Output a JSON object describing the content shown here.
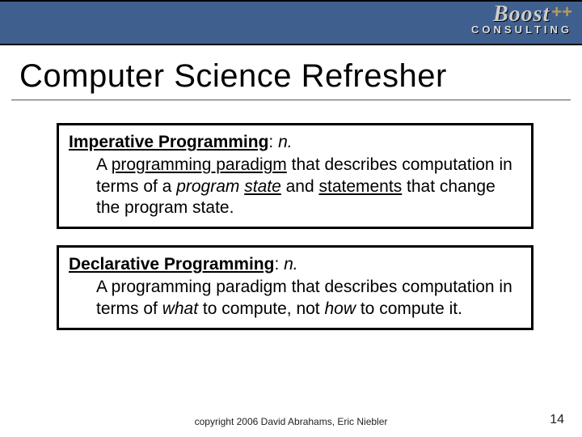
{
  "logo": {
    "main": "Boost",
    "plus": "++",
    "sub": "CONSULTING"
  },
  "title": "Computer Science Refresher",
  "definitions": [
    {
      "term": "Imperative Programming",
      "pos": "n.",
      "body_parts": [
        {
          "text": "A "
        },
        {
          "text": "programming paradigm",
          "style": "link"
        },
        {
          "text": " that describes computation in terms of a "
        },
        {
          "text": "program ",
          "style": "ital"
        },
        {
          "text": "state",
          "style": "link ital"
        },
        {
          "text": " and "
        },
        {
          "text": "statements",
          "style": "link"
        },
        {
          "text": " that change the program state."
        }
      ]
    },
    {
      "term": "Declarative Programming",
      "pos": "n.",
      "body_parts": [
        {
          "text": "A programming paradigm that describes computation in terms of "
        },
        {
          "text": "what",
          "style": "ital"
        },
        {
          "text": " to compute, not "
        },
        {
          "text": "how",
          "style": "ital"
        },
        {
          "text": " to compute it."
        }
      ]
    }
  ],
  "footer": "copyright 2006 David Abrahams, Eric Niebler",
  "page_number": "14"
}
